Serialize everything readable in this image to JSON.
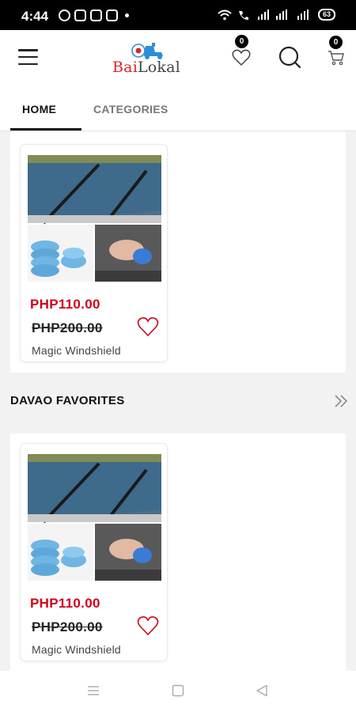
{
  "status_bar": {
    "time": "4:44",
    "battery": "63"
  },
  "header": {
    "logo_text_red": "Bai",
    "logo_text_dark": "Lokal",
    "wishlist_count": "0",
    "cart_count": "0"
  },
  "tabs": [
    {
      "label": "HOME",
      "active": true
    },
    {
      "label": "CATEGORIES",
      "active": false
    }
  ],
  "sections": [
    {
      "title": "",
      "products": [
        {
          "sale_price": "PHP110.00",
          "original_price": "PHP200.00",
          "name": "Magic Windshield"
        }
      ]
    },
    {
      "title": "DAVAO FAVORITES",
      "products": [
        {
          "sale_price": "PHP110.00",
          "original_price": "PHP200.00",
          "name": "Magic Windshield"
        }
      ]
    }
  ],
  "colors": {
    "accent_red": "#d0021b",
    "logo_red": "#d9262a",
    "logo_blue": "#2b8fd6",
    "text_dark": "#111111"
  }
}
